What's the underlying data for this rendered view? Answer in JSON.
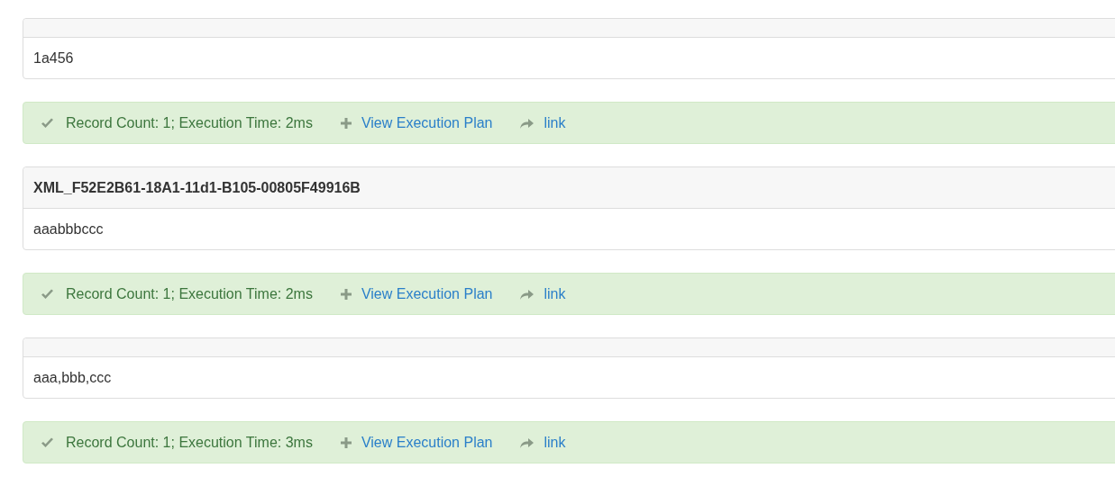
{
  "results": [
    {
      "value": "1a456",
      "status": {
        "message": "Record Count: 1; Execution Time: 2ms",
        "plan_link": "View Execution Plan",
        "link": "link"
      }
    },
    {
      "column": "XML_F52E2B61-18A1-11d1-B105-00805F49916B",
      "value": "aaabbbccc",
      "status": {
        "message": "Record Count: 1; Execution Time: 2ms",
        "plan_link": "View Execution Plan",
        "link": "link"
      }
    },
    {
      "value": "aaa,bbb,ccc",
      "status": {
        "message": "Record Count: 1; Execution Time: 3ms",
        "plan_link": "View Execution Plan",
        "link": "link"
      }
    }
  ]
}
